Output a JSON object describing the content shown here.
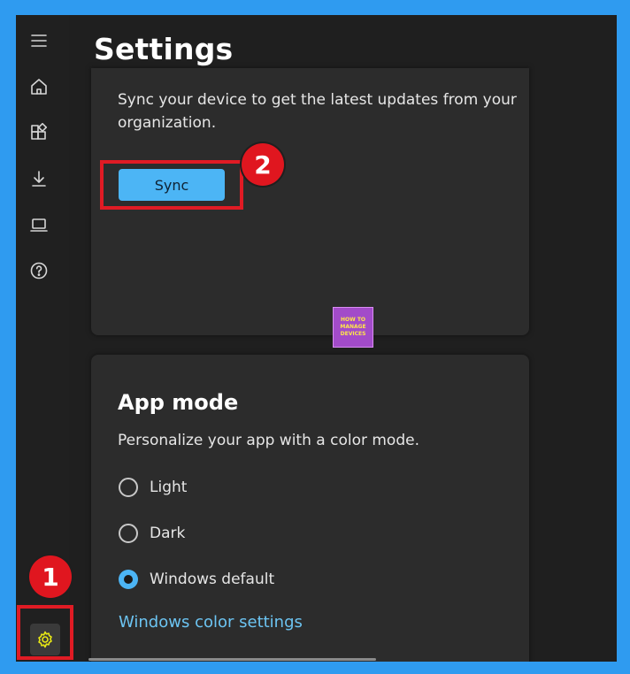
{
  "header": {
    "title": "Settings"
  },
  "sidebar": {
    "items": [
      {
        "name": "menu",
        "icon": "hamburger-icon"
      },
      {
        "name": "home",
        "icon": "home-icon"
      },
      {
        "name": "apps",
        "icon": "apps-icon"
      },
      {
        "name": "downloads",
        "icon": "download-icon"
      },
      {
        "name": "devices",
        "icon": "laptop-icon"
      },
      {
        "name": "help",
        "icon": "help-icon"
      },
      {
        "name": "settings",
        "icon": "gear-icon"
      }
    ]
  },
  "sync": {
    "description": "Sync your device to get the latest updates from your organization.",
    "button_label": "Sync"
  },
  "app_mode": {
    "title": "App mode",
    "description": "Personalize your app with a color mode.",
    "options": [
      {
        "label": "Light",
        "selected": false
      },
      {
        "label": "Dark",
        "selected": false
      },
      {
        "label": "Windows default",
        "selected": true
      }
    ],
    "link": "Windows color settings"
  },
  "annotations": {
    "step1": "1",
    "step2": "2"
  },
  "watermark": {
    "lines": [
      "HOW TO",
      "MANAGE",
      "DEVICES"
    ]
  },
  "colors": {
    "accent": "#4cb5f5",
    "annotation_red": "#e01b24",
    "background": "#2f9bf0"
  }
}
